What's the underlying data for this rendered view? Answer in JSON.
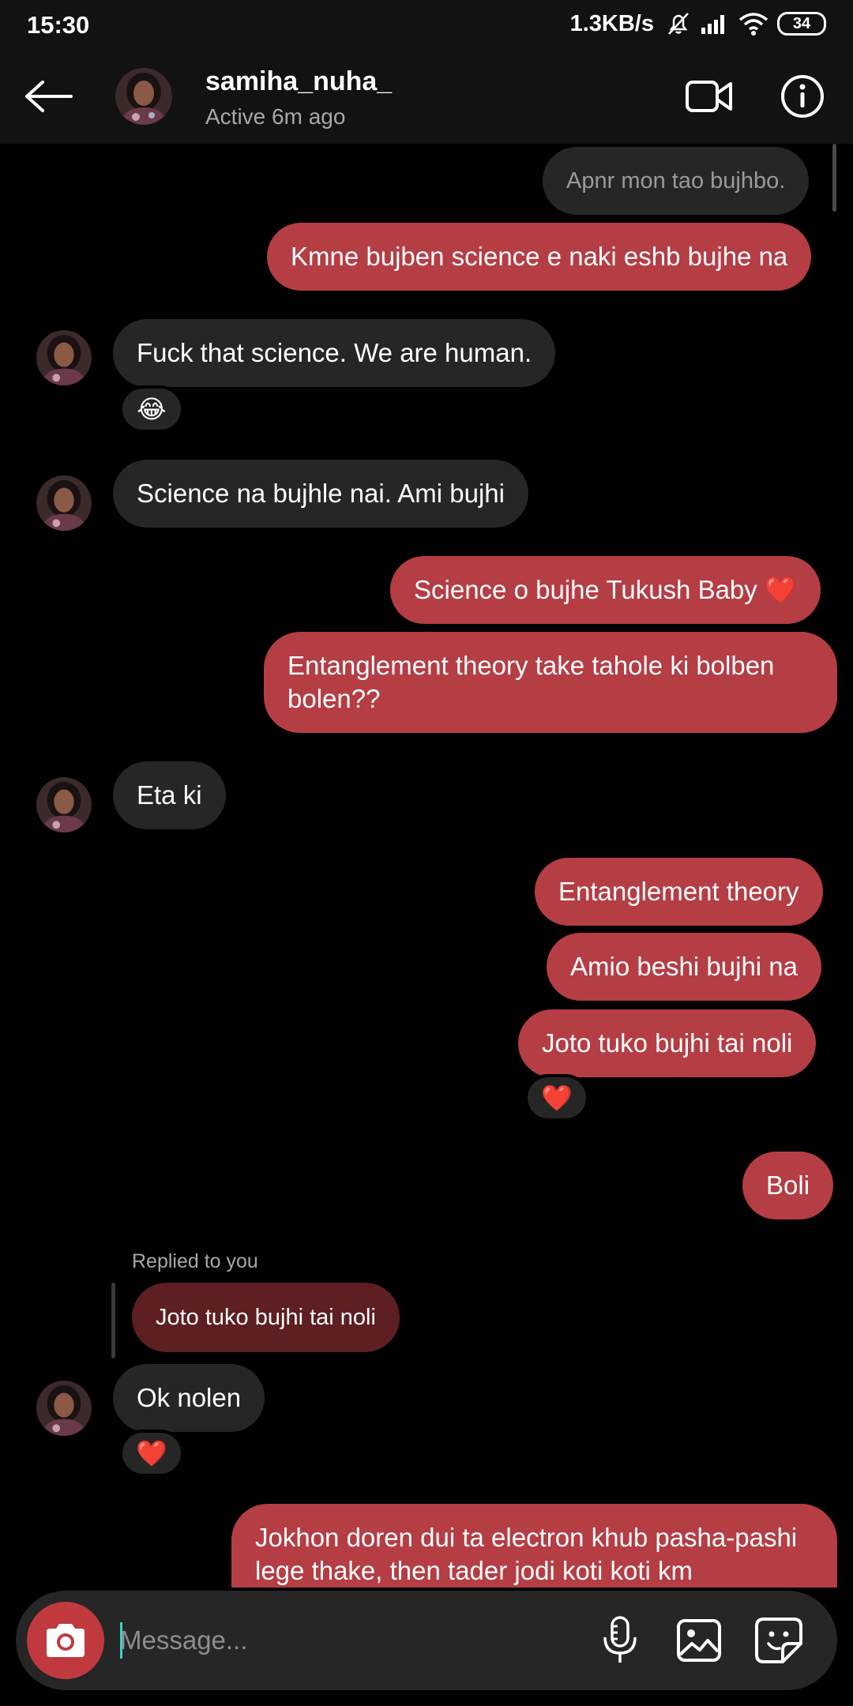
{
  "status_bar": {
    "time": "15:30",
    "net_speed": "1.3KB/s",
    "battery": "34"
  },
  "header": {
    "username": "samiha_nuha_",
    "activity": "Active 6m ago"
  },
  "messages": {
    "m0": "Apnr mon tao bujhbo.",
    "m1": "Kmne bujben science e naki eshb bujhe na",
    "m2": "Fuck that science. We are human.",
    "m2_reaction": "😂",
    "m3": "Science na bujhle nai. Ami bujhi",
    "m4": "Science o bujhe Tukush Baby ❤️",
    "m5": "Entanglement theory take tahole ki bolben bolen??",
    "m6": "Eta ki",
    "m7": "Entanglement theory",
    "m8": "Amio beshi bujhi na",
    "m9": "Joto tuko bujhi tai noli",
    "m9_reaction": "❤️",
    "m10": "Boli",
    "reply_label": "Replied to you",
    "reply_quote": "Joto tuko bujhi tai noli",
    "m11": "Ok nolen",
    "m11_reaction": "❤️",
    "m12": "Jokhon doren dui ta electron khub  pasha-pashi lege thake, then tader jodi koti koti km"
  },
  "composer": {
    "placeholder": "Message..."
  },
  "colors": {
    "outgoing_bubble": "#b53d44",
    "incoming_bubble": "#262626",
    "reply_bubble": "#5d1f22",
    "camera_button": "#c0393f",
    "caret": "#3bd0c8"
  }
}
